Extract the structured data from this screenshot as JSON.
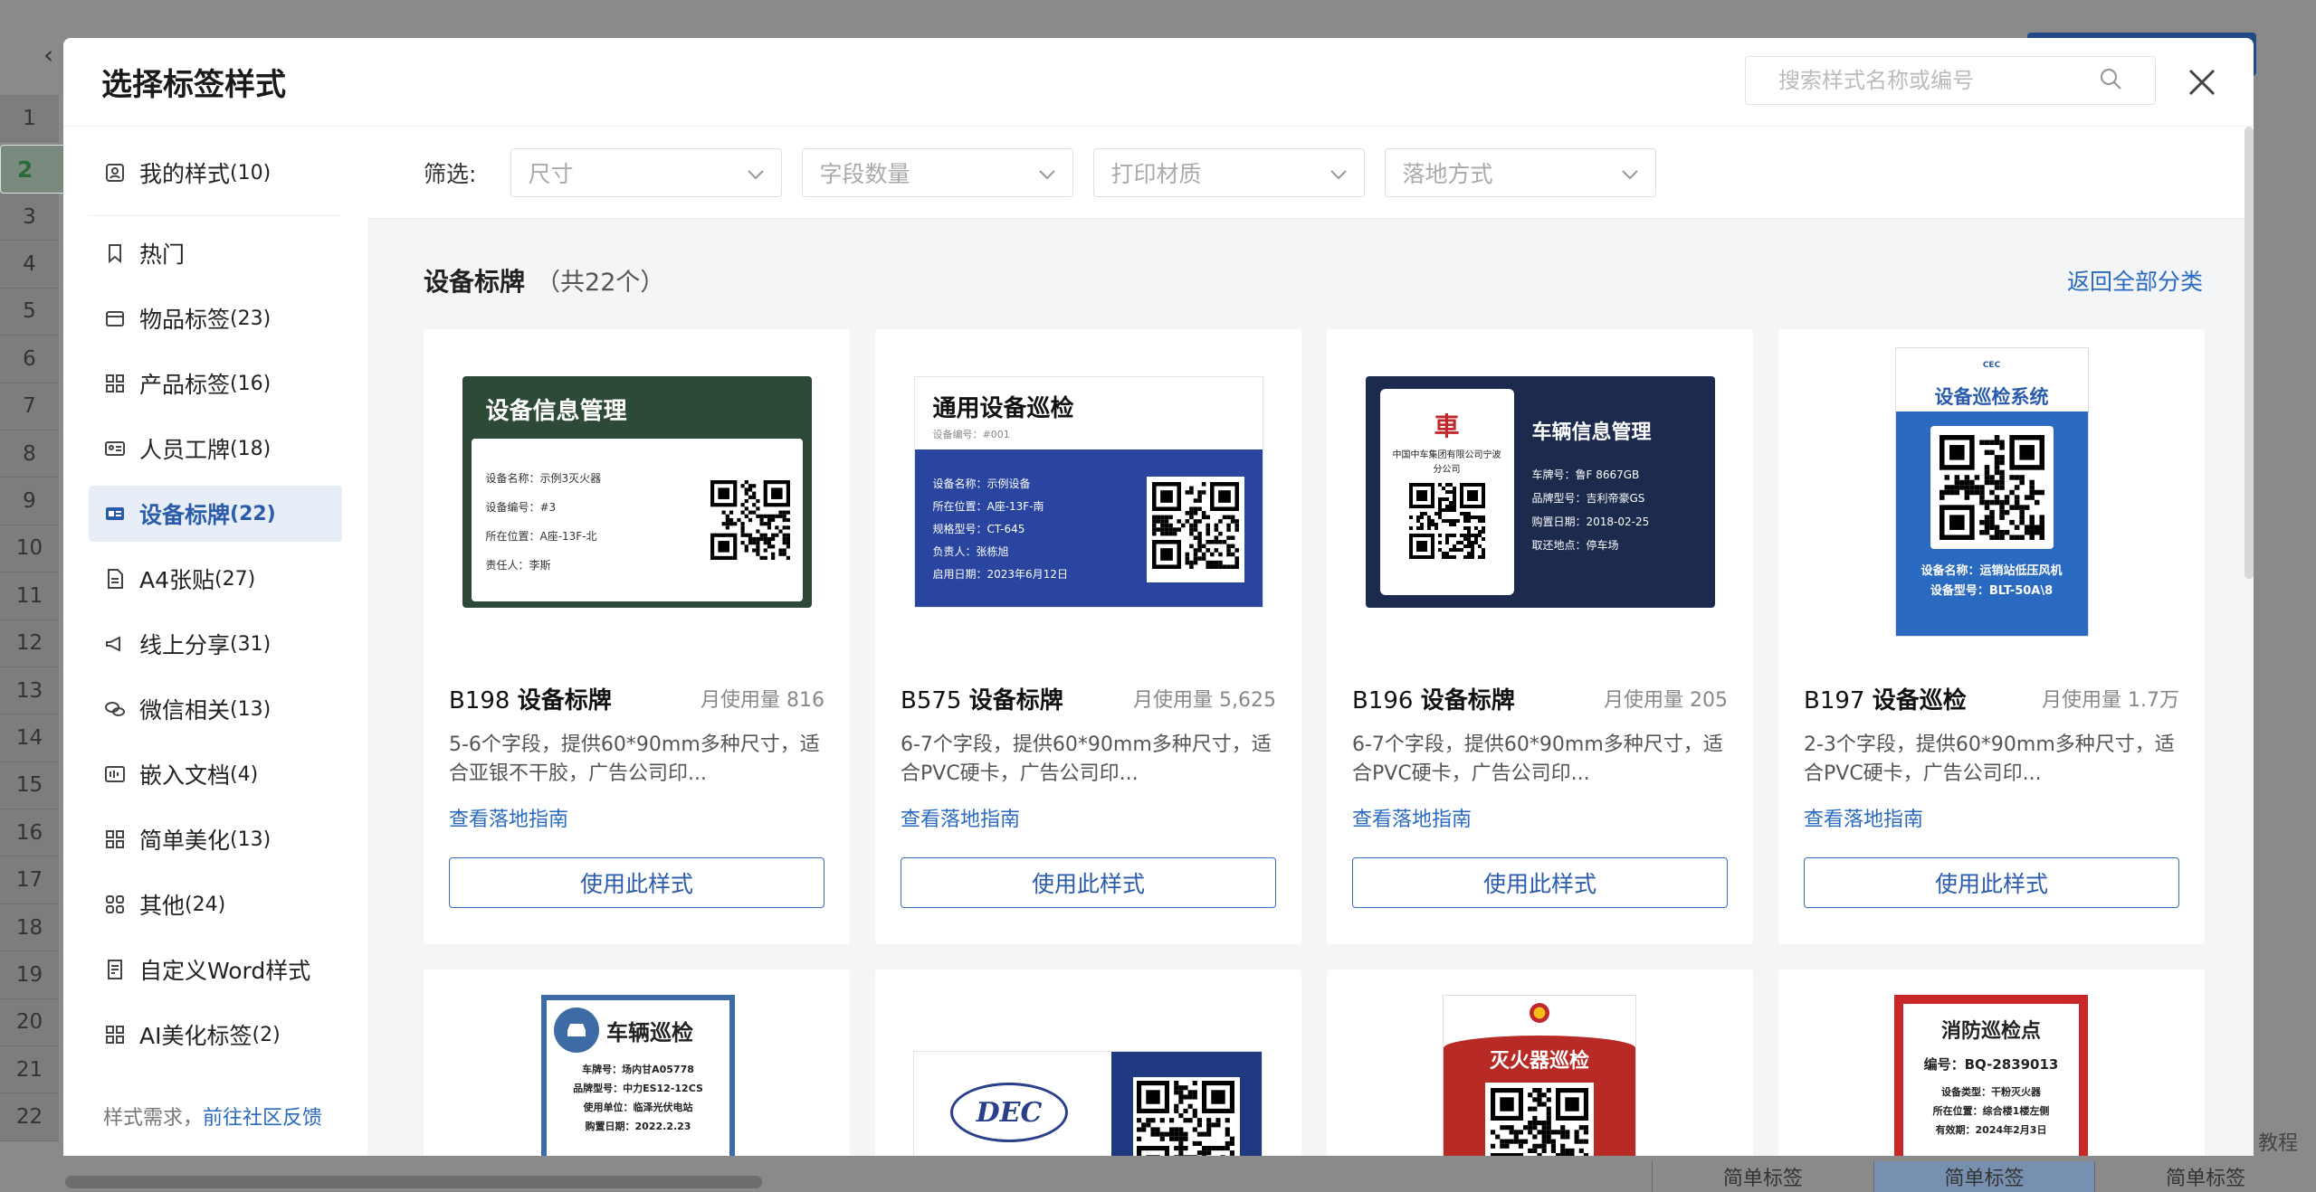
{
  "background": {
    "row_numbers": [
      "2",
      "3",
      "4",
      "5",
      "6",
      "7",
      "8",
      "9",
      "10",
      "11",
      "12",
      "13",
      "14",
      "15",
      "16",
      "17",
      "18",
      "19",
      "20",
      "21",
      "22"
    ],
    "row_first": "1",
    "bottom_tabs": [
      "简单标签",
      "简单标签",
      "简单标签"
    ],
    "help_text": "教程"
  },
  "modal": {
    "title": "选择标签样式",
    "search_placeholder": "搜索样式名称或编号"
  },
  "sidebar": {
    "my_styles": {
      "label": "我的样式",
      "count": "(10)"
    },
    "items": [
      {
        "label": "热门",
        "count": "",
        "icon": "bookmark-icon"
      },
      {
        "label": "物品标签",
        "count": "(23)",
        "icon": "box-icon"
      },
      {
        "label": "产品标签",
        "count": "(16)",
        "icon": "grid-icon"
      },
      {
        "label": "人员工牌",
        "count": "(18)",
        "icon": "id-card-icon"
      },
      {
        "label": "设备标牌",
        "count": "(22)",
        "icon": "device-icon"
      },
      {
        "label": "A4张贴",
        "count": "(27)",
        "icon": "document-icon"
      },
      {
        "label": "线上分享",
        "count": "(31)",
        "icon": "megaphone-icon"
      },
      {
        "label": "微信相关",
        "count": "(13)",
        "icon": "wechat-icon"
      },
      {
        "label": "嵌入文档",
        "count": "(4)",
        "icon": "embed-icon"
      },
      {
        "label": "简单美化",
        "count": "(13)",
        "icon": "grid-icon"
      },
      {
        "label": "其他",
        "count": "(24)",
        "icon": "apps-icon"
      },
      {
        "label": "自定义Word样式",
        "count": "",
        "icon": "word-icon"
      },
      {
        "label": "AI美化标签",
        "count": "(2)",
        "icon": "grid-icon"
      }
    ],
    "active_index": 4,
    "footer_text": "样式需求，",
    "footer_link": "前往社区反馈"
  },
  "filters": {
    "label": "筛选:",
    "options": [
      "尺寸",
      "字段数量",
      "打印材质",
      "落地方式"
    ]
  },
  "section": {
    "title": "设备标牌",
    "count": "（共22个）",
    "back_link": "返回全部分类"
  },
  "cards": [
    {
      "code": "B198",
      "name": "设备标牌",
      "usage": "月使用量 816",
      "desc": "5-6个字段，提供60*90mm多种尺寸，适合亚银不干胶，广告公司印...",
      "guide": "查看落地指南",
      "button": "使用此样式",
      "preview": {
        "title": "设备信息管理",
        "fields": [
          "设备名称：示例3灭火器",
          "设备编号：#3",
          "所在位置：A座-13F-北",
          "责任人：李斯"
        ]
      }
    },
    {
      "code": "B575",
      "name": "设备标牌",
      "usage": "月使用量 5,625",
      "desc": "6-7个字段，提供60*90mm多种尺寸，适合PVC硬卡，广告公司印...",
      "guide": "查看落地指南",
      "button": "使用此样式",
      "preview": {
        "title": "通用设备巡检",
        "subtitle": "设备编号：#001",
        "fields": [
          "设备名称：示例设备",
          "所在位置：A座-13F-南",
          "规格型号：CT-645",
          "负责人：张栋旭",
          "启用日期：2023年6月12日"
        ]
      }
    },
    {
      "code": "B196",
      "name": "设备标牌",
      "usage": "月使用量 205",
      "desc": "6-7个字段，提供60*90mm多种尺寸，适合PVC硬卡，广告公司印...",
      "guide": "查看落地指南",
      "button": "使用此样式",
      "preview": {
        "title": "车辆信息管理",
        "org": "中国中车集团有限公司宁波分公司",
        "fields": [
          "车牌号：鲁F 8667GB",
          "品牌型号：吉利帝豪GS",
          "购置日期：2018-02-25",
          "取还地点：停车场"
        ]
      }
    },
    {
      "code": "B197",
      "name": "设备巡检",
      "usage": "月使用量 1.7万",
      "desc": "2-3个字段，提供60*90mm多种尺寸，适合PVC硬卡，广告公司印...",
      "guide": "查看落地指南",
      "button": "使用此样式",
      "preview": {
        "title": "设备巡检系统",
        "logo": "CEC",
        "fields": [
          "设备名称：运销站低压风机",
          "设备型号：BLT-50A\\8"
        ]
      }
    }
  ],
  "cards_row2": [
    {
      "title": "车辆巡检",
      "fields": [
        "车牌号：场内甘A05778",
        "品牌型号：中力ES12-12CS",
        "使用单位：临泽光伏电站",
        "购置日期：2022.2.23"
      ]
    },
    {
      "logo": "DEC"
    },
    {
      "title": "灭火器巡检"
    },
    {
      "title": "消防巡检点",
      "fields": [
        "编号：BQ-2839013",
        "设备类型：干粉灭火器",
        "所在位置：综合楼1楼左侧",
        "有效期：2024年2月3日"
      ]
    }
  ]
}
